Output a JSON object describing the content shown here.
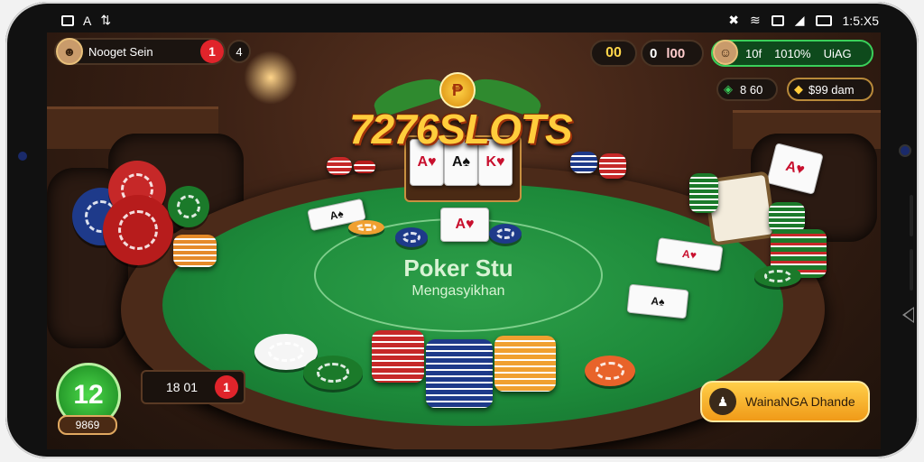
{
  "status_bar": {
    "left_icons": [
      "image-icon",
      "font-icon",
      "sync-icon"
    ],
    "left_text": "A",
    "right_icons": [
      "bluetooth-icon",
      "wifi-icon",
      "nfc-icon",
      "signal-icon",
      "battery-icon"
    ],
    "time": "1:5:X5"
  },
  "header": {
    "player_name": "Nooget Sein",
    "player_badge": "1",
    "player_extra": "4",
    "coin_a": "00",
    "coin_b": "0",
    "coin_c": "l00",
    "opponent_label": "10f",
    "opponent_value": "1010%",
    "opponent_status": "UiAG",
    "bonus_value": "8 60",
    "bonus_label": "$99 dam"
  },
  "logo": {
    "coin_glyph": "₱",
    "title": "7276SLOTS"
  },
  "table": {
    "title": "Poker Stu",
    "subtitle": "Mengasyikhan"
  },
  "cards": [
    {
      "rank": "A",
      "suit": "♥",
      "color": "red"
    },
    {
      "rank": "A",
      "suit": "♠",
      "color": "black"
    },
    {
      "rank": "K",
      "suit": "♥",
      "color": "red"
    },
    {
      "rank": "A",
      "suit": "♠",
      "color": "black"
    },
    {
      "rank": "A",
      "suit": "♥",
      "color": "red"
    },
    {
      "rank": "A",
      "suit": "♠",
      "color": "black"
    },
    {
      "rank": "A",
      "suit": "♥",
      "color": "red"
    }
  ],
  "bottom_left": {
    "level": "12",
    "level_sub": "9869",
    "bet_value": "18 01",
    "bet_badge": "1"
  },
  "cta": {
    "icon": "♟",
    "label": "WainaNGA Dhande"
  },
  "colors": {
    "felt": "#1d8a3a",
    "accent_gold": "#ffcd3c",
    "badge_red": "#e0242b",
    "badge_green": "#17821e"
  }
}
